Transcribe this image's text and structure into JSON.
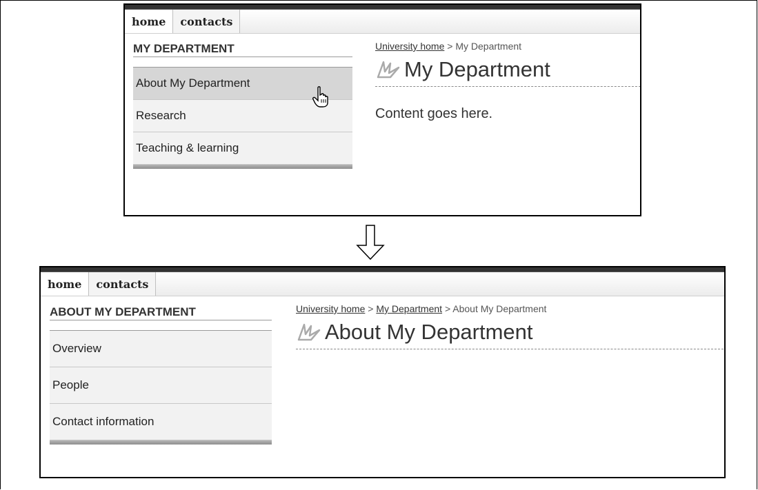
{
  "before": {
    "nav": {
      "tabs": [
        "home",
        "contacts"
      ]
    },
    "sidebar": {
      "title": "MY DEPARTMENT",
      "items": [
        "About My Department",
        "Research",
        "Teaching & learning"
      ]
    },
    "breadcrumb": {
      "links": [
        "University home"
      ],
      "separator": ">",
      "current": "My Department"
    },
    "heading": "My Department",
    "content": "Content goes here."
  },
  "after": {
    "nav": {
      "tabs": [
        "home",
        "contacts"
      ]
    },
    "sidebar": {
      "title": "ABOUT MY DEPARTMENT",
      "items": [
        "Overview",
        "People",
        "Contact information"
      ]
    },
    "breadcrumb": {
      "links": [
        "University home",
        "My Department"
      ],
      "separator": ">",
      "current": "About My Department"
    },
    "heading": "About My Department"
  },
  "icons": {
    "logo": "bird-logo-icon",
    "cursor": "hand-pointer-icon",
    "arrow": "down-arrow-icon"
  },
  "colors": {
    "topbar": "#333333",
    "sidebar_item_bg": "#f2f2f2",
    "sidebar_hover_bg": "#d6d6d6"
  }
}
